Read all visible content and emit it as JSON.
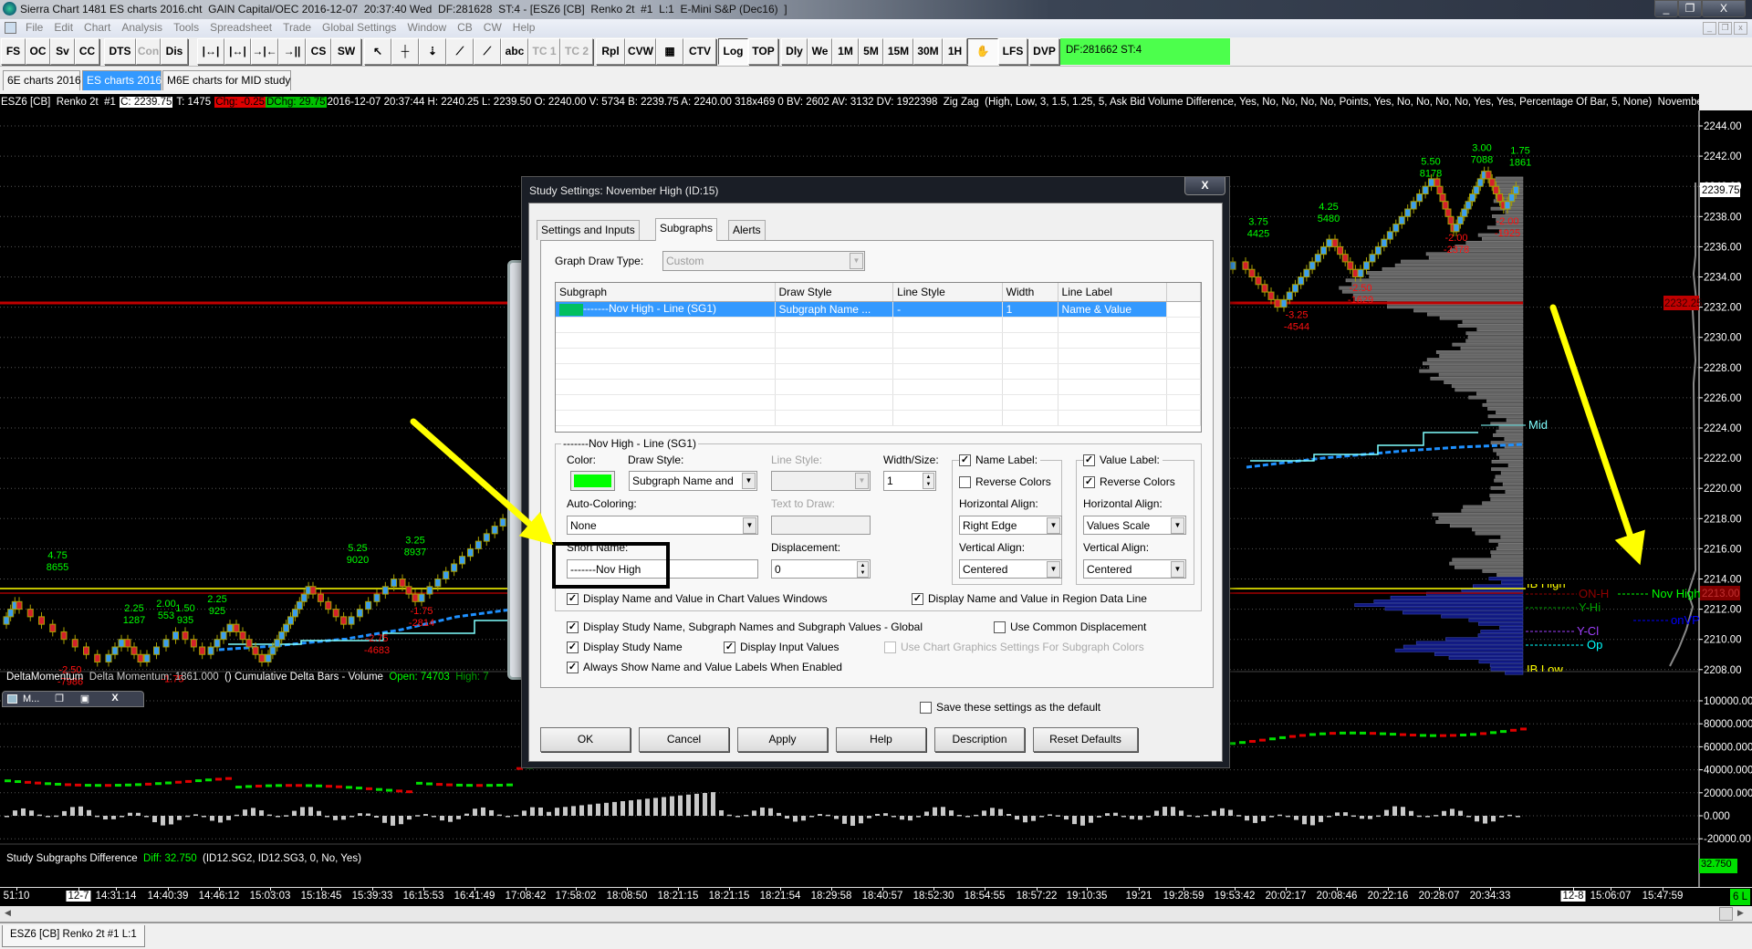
{
  "window": {
    "title": "Sierra Chart 1481 ES charts 2016.cht  GAIN Capital/OEC 2016-12-07  20:37:40 Wed  DF:281628  ST:4 - [ESZ6 [CB]  Renko 2t  #1  L:1  E-Mini S&P (Dec16)  ]",
    "minimize": "_",
    "restore": "❐",
    "close": "X"
  },
  "menu": [
    "File",
    "Edit",
    "Chart",
    "Analysis",
    "Tools",
    "Spreadsheet",
    "Trade",
    "Global Settings",
    "Window",
    "CB",
    "CW",
    "Help"
  ],
  "toolbar": {
    "buttons": [
      {
        "label": "FS",
        "w": 27
      },
      {
        "label": "OC",
        "w": 27
      },
      {
        "label": "Sv",
        "w": 27
      },
      {
        "label": "CC",
        "w": 27,
        "gap": 5
      },
      {
        "label": "DTS",
        "w": 35
      },
      {
        "label": "Con",
        "w": 27,
        "disabled": true
      },
      {
        "label": "Dis",
        "w": 30,
        "gap": 10
      },
      {
        "label": "|↔|",
        "w": 30
      },
      {
        "label": "|↔|",
        "w": 29
      },
      {
        "label": "→|←",
        "w": 30
      },
      {
        "label": "→||←",
        "w": 30
      },
      {
        "label": "CS",
        "w": 28
      },
      {
        "label": "SW",
        "w": 33,
        "gap": 3
      },
      {
        "label": "↖",
        "w": 30
      },
      {
        "label": "┼",
        "w": 30
      },
      {
        "label": "⇣",
        "w": 30
      },
      {
        "label": "⟋",
        "w": 30
      },
      {
        "label": "⟋",
        "w": 30
      },
      {
        "label": "abc",
        "w": 30
      },
      {
        "label": "TC 1",
        "w": 35,
        "disabled": true
      },
      {
        "label": "TC 2",
        "w": 36,
        "disabled": true,
        "gap": 3
      },
      {
        "label": "Rpl",
        "w": 32
      },
      {
        "label": "CVW",
        "w": 34
      },
      {
        "label": "▦",
        "w": 30
      },
      {
        "label": "CTV",
        "w": 36,
        "gap": 2
      },
      {
        "label": "Log",
        "w": 33,
        "pressed": true
      },
      {
        "label": "TOP",
        "w": 33,
        "gap": 3
      },
      {
        "label": "Dly",
        "w": 29
      },
      {
        "label": "We",
        "w": 27
      },
      {
        "label": "1M",
        "w": 29
      },
      {
        "label": "5M",
        "w": 27
      },
      {
        "label": "15M",
        "w": 33
      },
      {
        "label": "30M",
        "w": 32
      },
      {
        "label": "1H",
        "w": 27
      },
      {
        "label": "✋",
        "w": 34,
        "pressed": true
      },
      {
        "label": "LFS",
        "w": 32,
        "gap": 2
      },
      {
        "label": "DVP",
        "w": 33
      }
    ],
    "status": "DF:281662  ST:4",
    "status_color": "#4cff4c"
  },
  "chartbook_tabs": [
    "6E charts 2016",
    "ES charts 2016",
    "M6E charts for MID study"
  ],
  "data_line": {
    "symbol": "ESZ6 [CB]  Renko 2t  #1 ",
    "close": "C: 2239.75",
    "trades": " T: 1475 ",
    "chg": "Chg: -0.25",
    "dchg": "DChg: 29.75",
    "details": "2016-12-07 20:37:44 H: 2240.25 L: 2239.50 O: 2240.00 V: 5734 B: 2239.75 A: 2240.00 318x469 0 BV: 2602 AV: 3132 DV: 1922398  Zig Zag  (High, Low, 3, 1.5, 1.25, 5, Ask Bid Volume Difference, Yes, No, No, No, No, Points, Yes, No, No, No, No, Yes, Yes, Percentage Of Bar, 5, None)  November Hig"
  },
  "price_axis": {
    "ticks": [
      "2244.00",
      "2242.00",
      "2240.00",
      "2238.00",
      "2236.00",
      "2234.00",
      "2232.00",
      "2230.00",
      "2228.00",
      "2226.00",
      "2224.00",
      "2222.00",
      "2220.00",
      "2218.00",
      "2216.00",
      "2214.00",
      "2212.00",
      "2210.00",
      "2208.00"
    ],
    "current": "2239.75",
    "red_level": "2232.25",
    "nov_high_value": "2213.00"
  },
  "levels": {
    "mid": "Mid",
    "ib_high": "IB High",
    "ib_low": "IB Low",
    "on_h": "ON-H",
    "y_hi": "Y-Hi",
    "onvp": "onVP",
    "y_cl": "Y-Cl",
    "op": "Op",
    "nov_high": "Nov High"
  },
  "chart_data": {
    "type": "renko",
    "brick_size": 0.5,
    "ylim": [
      2207.5,
      2245
    ],
    "swings": [
      [
        0,
        2211
      ],
      [
        2,
        2212.5
      ],
      [
        16,
        2208.5
      ],
      [
        19,
        2210
      ],
      [
        22,
        2208.5
      ],
      [
        28,
        2210.5
      ],
      [
        32,
        2209
      ],
      [
        36,
        2211
      ],
      [
        41,
        2208.5
      ],
      [
        48,
        2213.5
      ],
      [
        54,
        2211
      ],
      [
        62,
        2214
      ],
      [
        65,
        2212.5
      ],
      [
        79,
        2218
      ],
      [
        110,
        2225
      ],
      [
        120,
        2222
      ],
      [
        160,
        2231
      ],
      [
        170,
        2229
      ],
      [
        194,
        2235
      ],
      [
        200,
        2232
      ],
      [
        208,
        2236.5
      ],
      [
        212,
        2234
      ],
      [
        224,
        2240.5
      ],
      [
        227,
        2237
      ],
      [
        232,
        2241
      ],
      [
        235,
        2238.5
      ],
      [
        237,
        2239.75
      ]
    ],
    "zigzag_labels": [
      {
        "i": 8,
        "p": 2214.5,
        "a": "4.75",
        "b": "8655",
        "up": true
      },
      {
        "i": 20,
        "p": 2211,
        "a": "2.25",
        "b": "1287",
        "up": true
      },
      {
        "i": 25,
        "p": 2211.3,
        "a": "2.00",
        "b": "553",
        "up": true
      },
      {
        "i": 28,
        "p": 2211,
        "a": "1.50",
        "b": "935",
        "up": true
      },
      {
        "i": 33,
        "p": 2211.6,
        "a": "2.25",
        "b": "925",
        "up": true
      },
      {
        "i": 55,
        "p": 2215,
        "a": "5.25",
        "b": "9020",
        "up": true
      },
      {
        "i": 64,
        "p": 2215.5,
        "a": "3.25",
        "b": "8937",
        "up": true
      },
      {
        "i": 10,
        "p": 2208.5,
        "a": "-2.50",
        "b": "-7986",
        "up": false
      },
      {
        "i": 26,
        "p": 2207.9,
        "a": "-1.75",
        "b": "",
        "up": false
      },
      {
        "i": 58,
        "p": 2210.6,
        "a": "-2.75",
        "b": "-4683",
        "up": false
      },
      {
        "i": 65,
        "p": 2212.4,
        "a": "-1.75",
        "b": "-2814",
        "up": false
      },
      {
        "i": 196,
        "p": 2236.6,
        "a": "3.75",
        "b": "4425",
        "up": true
      },
      {
        "i": 207,
        "p": 2237.6,
        "a": "4.25",
        "b": "5480",
        "up": true
      },
      {
        "i": 223,
        "p": 2240.6,
        "a": "5.50",
        "b": "8178",
        "up": true
      },
      {
        "i": 231,
        "p": 2241.5,
        "a": "3.00",
        "b": "7088",
        "up": true
      },
      {
        "i": 237,
        "p": 2241.3,
        "a": "1.75",
        "b": "1861",
        "up": true
      },
      {
        "i": 202,
        "p": 2232,
        "a": "-3.25",
        "b": "-4544",
        "up": false
      },
      {
        "i": 212,
        "p": 2233.8,
        "a": "-2.50",
        "b": "-1629",
        "up": false
      },
      {
        "i": 227,
        "p": 2237.1,
        "a": "-2.00",
        "b": "-2378",
        "up": false
      },
      {
        "i": 235,
        "p": 2238.2,
        "a": "-2.00",
        "b": "-1925",
        "up": false
      }
    ]
  },
  "lower_panel": {
    "study": "DeltaMomentum",
    "momentum": "Delta Momentum: 1861.000",
    "paren": "()",
    "cum": "Cumulative Delta Bars - Volume",
    "open": "Open: 74703",
    "high": "High: 7",
    "ticks": [
      "100000.00",
      "80000.000",
      "60000.000",
      "40000.000",
      "20000.000",
      "0.000",
      "-20000.00"
    ],
    "diff_study": "Study Subgraphs Difference",
    "diff": "Diff: 32.750",
    "diff_params": "(ID12.SG2, ID12.SG3, 0, No, Yes)",
    "diff_value": "32.750"
  },
  "mini_window": {
    "label": "M...",
    "restore": "❐",
    "maximize": "▣",
    "close": "X"
  },
  "time_axis": {
    "labels": [
      "51:10",
      "12-7",
      "14:31:14",
      "14:40:39",
      "14:46:12",
      "15:03:03",
      "15:18:45",
      "15:39:33",
      "16:15:53",
      "16:41:49",
      "17:08:42",
      "17:58:02",
      "18:08:50",
      "18:21:15",
      "18:21:15",
      "18:21:54",
      "18:29:58",
      "18:40:57",
      "18:52:30",
      "18:54:55",
      "18:57:22",
      "19:10:35",
      "19:21",
      "19:28:59",
      "19:53:42",
      "20:02:17",
      "20:08:46",
      "20:22:16",
      "20:28:07",
      "20:34:33",
      "12-8",
      "15:06:07",
      "15:47:59"
    ],
    "corner": "6 L"
  },
  "bottom_tab": "ESZ6 [CB]  Renko 2t  #1  L:1",
  "dialog": {
    "title": "Study Settings: November High (ID:15)",
    "close": "X",
    "tabs": [
      "Settings and Inputs",
      "Subgraphs",
      "Alerts"
    ],
    "graph_draw_type_label": "Graph Draw Type:",
    "graph_draw_type": "Custom",
    "table": {
      "headers": [
        "Subgraph",
        "Draw Style",
        "Line Style",
        "Width",
        "Line Label"
      ],
      "rows": [
        [
          "-------Nov High - Line (SG1)",
          "Subgraph Name ...",
          "-",
          "1",
          "Name & Value"
        ]
      ],
      "swatch": "#00c060"
    },
    "group_title": "-------Nov High - Line (SG1)",
    "color_label": "Color:",
    "color": "#00ff00",
    "draw_style_label": "Draw Style:",
    "draw_style": "Subgraph Name and",
    "line_style_label": "Line Style:",
    "line_style": "",
    "width_label": "Width/Size:",
    "width": "1",
    "auto_coloring_label": "Auto-Coloring:",
    "auto_coloring": "None",
    "text_to_draw_label": "Text to Draw:",
    "text_to_draw": "",
    "short_name_label": "Short Name:",
    "short_name": "-------Nov High",
    "displacement_label": "Displacement:",
    "displacement": "0",
    "name_label": {
      "title": "Name Label:",
      "checked": true,
      "reverse": "Reverse Colors",
      "reverse_checked": false,
      "h_label": "Horizontal Align:",
      "h": "Right Edge",
      "v_label": "Vertical Align:",
      "v": "Centered"
    },
    "value_label": {
      "title": "Value Label:",
      "checked": true,
      "reverse": "Reverse Colors",
      "reverse_checked": true,
      "h_label": "Horizontal Align:",
      "h": "Values Scale",
      "v_label": "Vertical Align:",
      "v": "Centered"
    },
    "checks": {
      "chart_values": "Display Name and Value in Chart Values Windows",
      "region_data": "Display Name and Value in Region Data Line",
      "global": "Display Study Name, Subgraph Names and Subgraph Values - Global",
      "common_disp": "Use Common Displacement",
      "study_name": "Display Study Name",
      "input_values": "Display Input Values",
      "chart_graphics": "Use Chart Graphics Settings For Subgraph Colors",
      "always_show": "Always Show Name and Value Labels When Enabled",
      "save_default": "Save these settings as the default"
    },
    "buttons": [
      "OK",
      "Cancel",
      "Apply",
      "Help",
      "Description",
      "Reset Defaults"
    ]
  },
  "colors": {
    "up_brick": "#3a9ef0",
    "down_brick": "#d4202c",
    "brick_border": "#a8a000",
    "zig_up": "#00ff00",
    "zig_down": "#ff1010",
    "annotation": "#ffff00"
  }
}
